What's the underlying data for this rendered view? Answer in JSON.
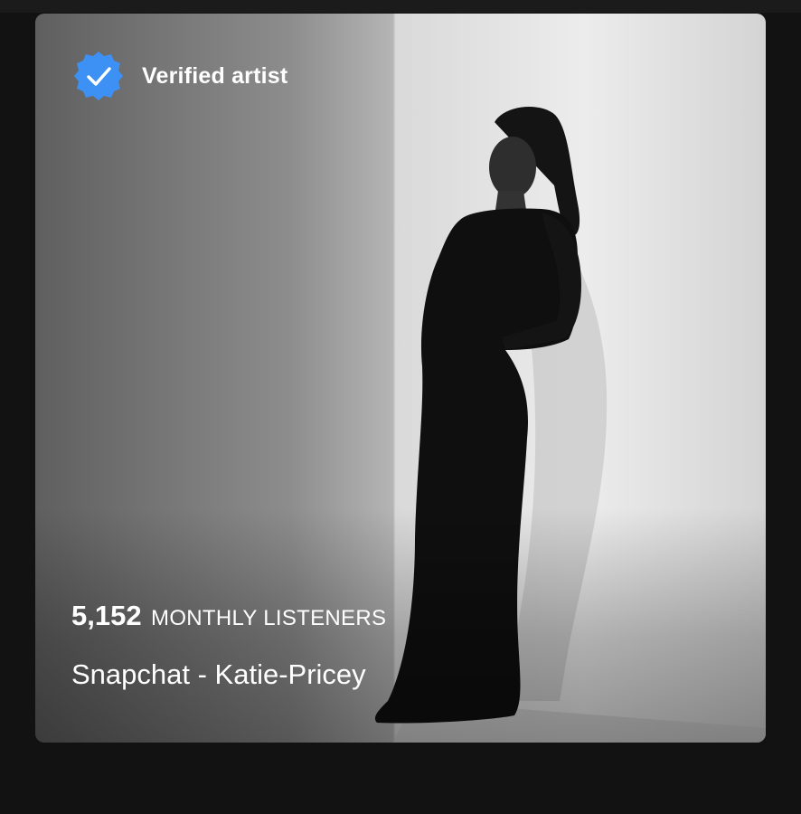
{
  "artist_card": {
    "verified_label": "Verified artist",
    "verified_icon": "verified-check-icon",
    "listeners_count": "5,152",
    "listeners_label": "MONTHLY LISTENERS",
    "bio": "Snapchat - Katie-Pricey",
    "badge_color": "#3d91f4"
  }
}
